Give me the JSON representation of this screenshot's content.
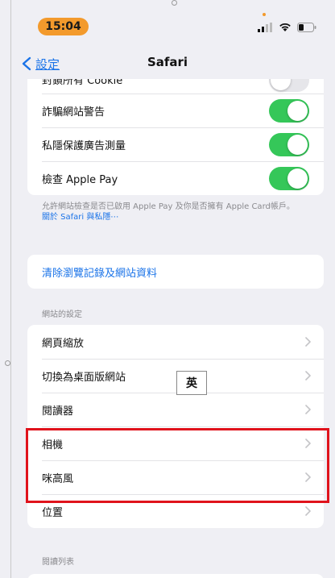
{
  "status_bar": {
    "time": "15:04"
  },
  "nav": {
    "back_label": "設定",
    "title": "Safari"
  },
  "privacy_group": {
    "clipped_row_label": "封鎖所有 Cookie",
    "rows": [
      {
        "label": "詐騙網站警告",
        "toggle": "on"
      },
      {
        "label": "私隱保護廣告測量",
        "toggle": "on"
      },
      {
        "label": "檢查 Apple Pay",
        "toggle": "on"
      }
    ],
    "footnote": "允許網站檢查是否已啟用 Apple Pay 及你是否擁有 Apple Card帳戶。",
    "footnote_link": "關於 Safari 與私隱⋯"
  },
  "clear_history": {
    "label": "清除瀏覽記錄及網站資料"
  },
  "website_settings": {
    "header": "網站的設定",
    "rows": [
      {
        "label": "網頁縮放"
      },
      {
        "label": "切換為桌面版網站"
      },
      {
        "label": "閱讀器"
      },
      {
        "label": "相機"
      },
      {
        "label": "咪高風"
      },
      {
        "label": "位置"
      }
    ]
  },
  "reading_list": {
    "header": "閱讀列表"
  },
  "ime_indicator": "英",
  "colors": {
    "accent": "#1a73e8",
    "toggle_on": "#35c759",
    "highlight": "#e0131c",
    "time_pill": "#f39a2c"
  }
}
